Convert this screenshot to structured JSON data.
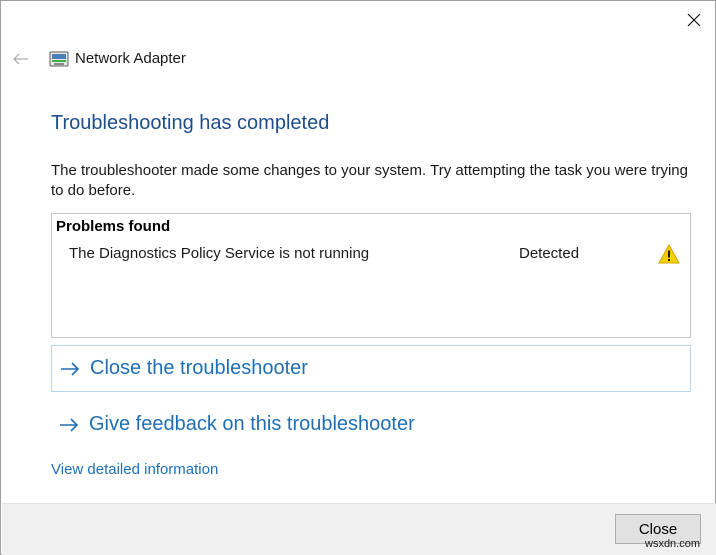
{
  "window": {
    "title": "Network Adapter",
    "close_glyph": "close-icon",
    "back_glyph": "back-arrow-icon"
  },
  "heading": "Troubleshooting has completed",
  "description": "The troubleshooter made some changes to your system. Try attempting the task you were trying to do before.",
  "problems": {
    "header": "Problems found",
    "items": [
      {
        "name": "The Diagnostics Policy Service is not running",
        "status": "Detected",
        "icon": "warning-icon"
      }
    ]
  },
  "actions": {
    "close_troubleshooter": "Close the troubleshooter",
    "give_feedback": "Give feedback on this troubleshooter"
  },
  "details_link": "View detailed information",
  "footer": {
    "close_button": "Close"
  },
  "watermark": "wsxdn.com",
  "colors": {
    "heading": "#1f4e8c",
    "link": "#1f6fb5",
    "footer_bg": "#f0f0f0",
    "warning": "#f7d000"
  }
}
